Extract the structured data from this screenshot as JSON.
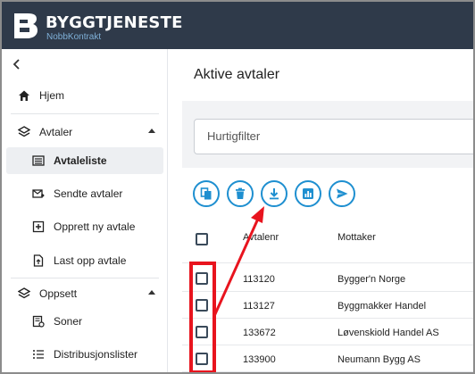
{
  "header": {
    "brand": "BYGGTJENESTE",
    "sub": "NobbKontrakt"
  },
  "sidebar": {
    "collapse_icon": "chevron-left-icon",
    "items": [
      {
        "label": "Hjem",
        "icon": "home-icon"
      },
      {
        "label": "Avtaler",
        "icon": "layers-icon",
        "expanded": true
      },
      {
        "label": "Avtaleliste",
        "icon": "list-icon",
        "active": true
      },
      {
        "label": "Sendte avtaler",
        "icon": "mail-send-icon"
      },
      {
        "label": "Opprett ny avtale",
        "icon": "plus-box-icon"
      },
      {
        "label": "Last opp avtale",
        "icon": "file-upload-icon"
      },
      {
        "label": "Oppsett",
        "icon": "layers-icon",
        "expanded": true
      },
      {
        "label": "Soner",
        "icon": "zones-icon"
      },
      {
        "label": "Distribusjonslister",
        "icon": "list-lines-icon"
      }
    ]
  },
  "main": {
    "title": "Aktive avtaler",
    "filter_placeholder": "Hurtigfilter",
    "toolbar": [
      "copy-icon",
      "delete-icon",
      "download-icon",
      "report-icon",
      "send-icon"
    ],
    "table": {
      "columns": [
        "Avtalenr",
        "Mottaker"
      ],
      "rows": [
        {
          "id": "113120",
          "recipient": "Bygger'n Norge"
        },
        {
          "id": "113127",
          "recipient": "Byggmakker Handel"
        },
        {
          "id": "133672",
          "recipient": "Løvenskiold Handel AS"
        },
        {
          "id": "133900",
          "recipient": "Neumann Bygg AS"
        }
      ]
    }
  },
  "annotation": {
    "color": "#e8141e"
  },
  "colors": {
    "header": "#2f3a4a",
    "accent": "#1e8fd0"
  }
}
